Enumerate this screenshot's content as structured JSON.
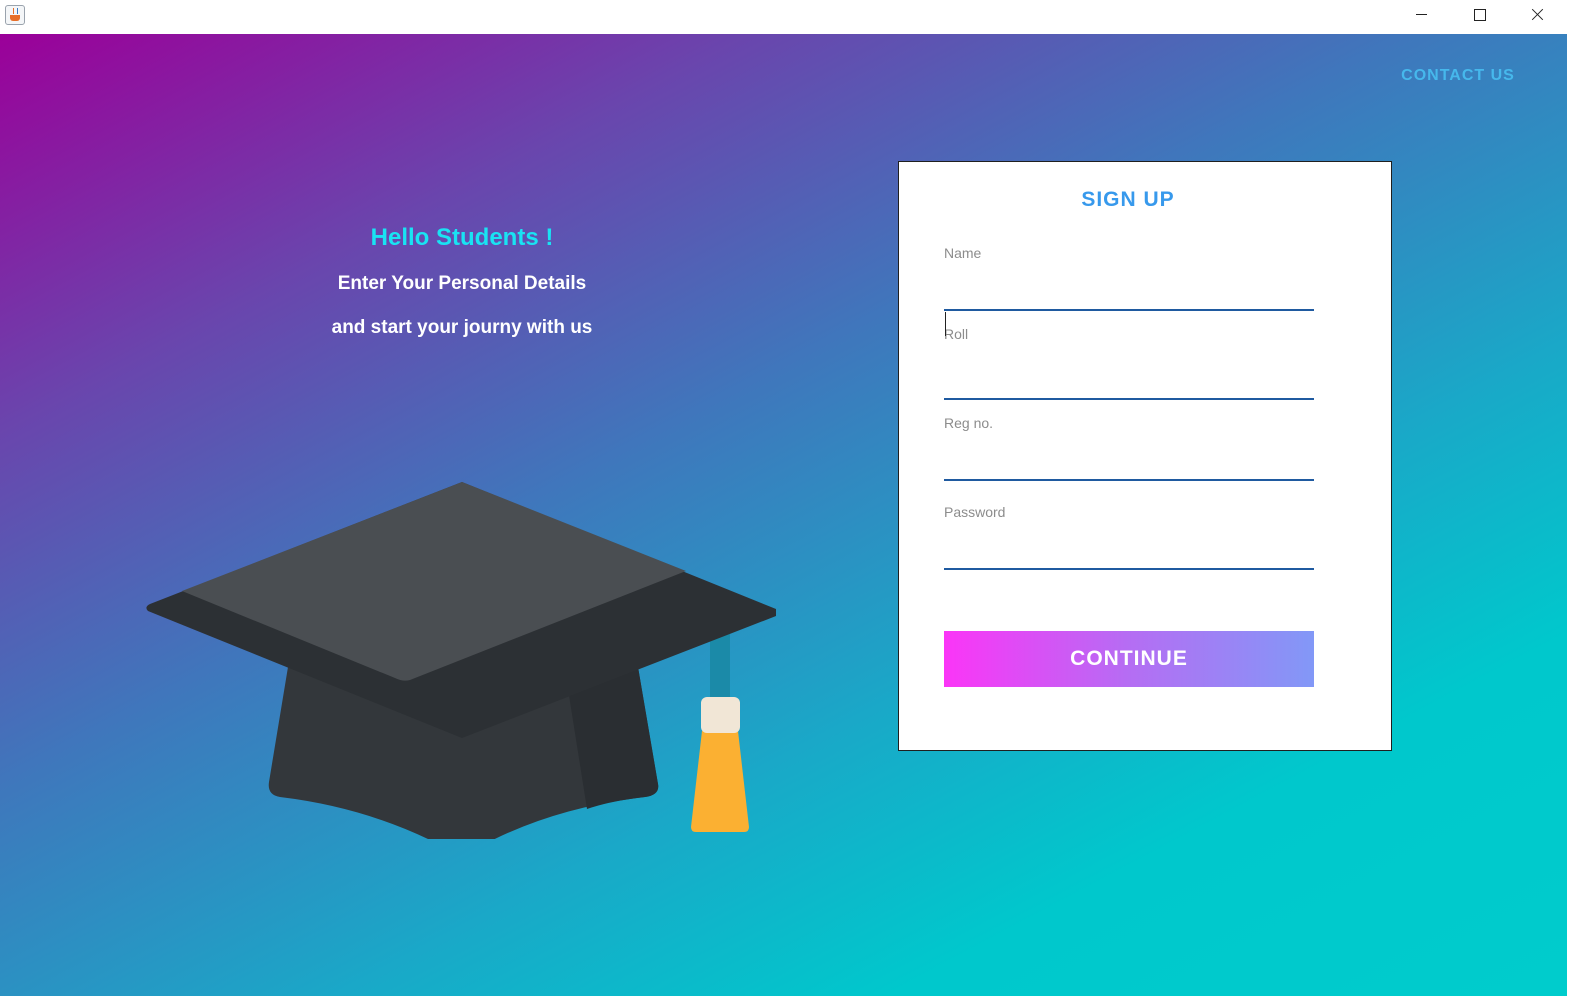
{
  "window": {
    "title": "",
    "controls": [
      "minimize",
      "maximize",
      "close"
    ]
  },
  "nav": {
    "contact_label": "CONTACT US"
  },
  "hero": {
    "greeting": "Hello Students !",
    "line1": "Enter Your Personal Details",
    "line2": "and start your journy with us",
    "illustration": "graduation-cap"
  },
  "signup": {
    "title": "SIGN UP",
    "fields": [
      {
        "label": "Name",
        "value": ""
      },
      {
        "label": "Roll",
        "value": ""
      },
      {
        "label": "Reg no.",
        "value": ""
      },
      {
        "label": "Password",
        "value": ""
      }
    ],
    "submit_label": "CONTINUE"
  },
  "colors": {
    "gradient_start": "#9b0099",
    "gradient_end": "#00cccc",
    "greeting": "#19e3f3",
    "contact_link": "#46b8ec",
    "card_title": "#3799ec",
    "input_underline": "#1f5aa0",
    "button_start": "#fb35f7",
    "button_end": "#8298f7"
  }
}
